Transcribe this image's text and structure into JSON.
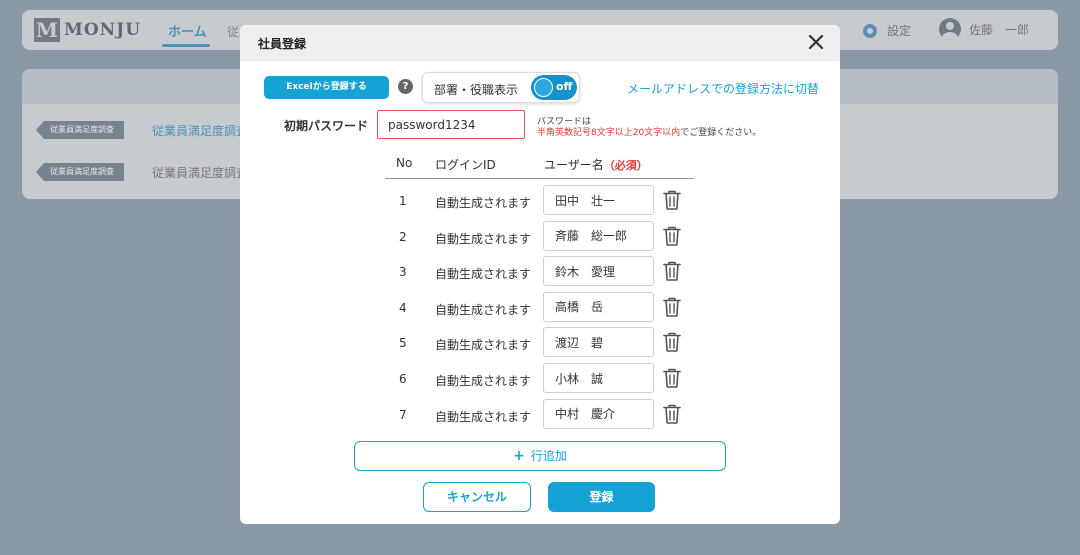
{
  "app": {
    "logo_mark": "M",
    "logo_text": "MONJU",
    "nav_home": "ホーム",
    "nav_partial": "従",
    "settings_label": "設定",
    "user_name": "佐藤　一郎"
  },
  "background": {
    "rows": [
      {
        "tag": "従業員満足度調査",
        "title": "従業員満足度調査"
      },
      {
        "tag": "従業員満足度調査",
        "title": "従業員満足度調査"
      }
    ]
  },
  "modal": {
    "title": "社員登録",
    "excel_button": "Excelから登録する",
    "help_glyph": "?",
    "toggle_label": "部署・役職表示",
    "toggle_state": "off",
    "switch_link": "メールアドレスでの登録方法に切替",
    "password_label": "初期パスワード",
    "password_value": "password1234",
    "password_note_line1": "パスワードは",
    "password_note_rule": "半角英数記号8文字以上20文字以内",
    "password_note_suffix": "でご登録ください。",
    "columns": {
      "no": "No",
      "login_id": "ログインID",
      "user_name": "ユーザー名",
      "required": "（必須）"
    },
    "rows": [
      {
        "no": "1",
        "login_id": "自動生成されます",
        "name": "田中　壮一"
      },
      {
        "no": "2",
        "login_id": "自動生成されます",
        "name": "斉藤　総一郎"
      },
      {
        "no": "3",
        "login_id": "自動生成されます",
        "name": "鈴木　愛理"
      },
      {
        "no": "4",
        "login_id": "自動生成されます",
        "name": "高橋　岳"
      },
      {
        "no": "5",
        "login_id": "自動生成されます",
        "name": "渡辺　碧"
      },
      {
        "no": "6",
        "login_id": "自動生成されます",
        "name": "小林　誠"
      },
      {
        "no": "7",
        "login_id": "自動生成されます",
        "name": "中村　慶介"
      }
    ],
    "add_row_label": "行追加",
    "cancel_label": "キャンセル",
    "submit_label": "登録"
  },
  "colors": {
    "accent": "#15a3d6",
    "required": "#e53935",
    "backdrop": "#8b98a6"
  }
}
